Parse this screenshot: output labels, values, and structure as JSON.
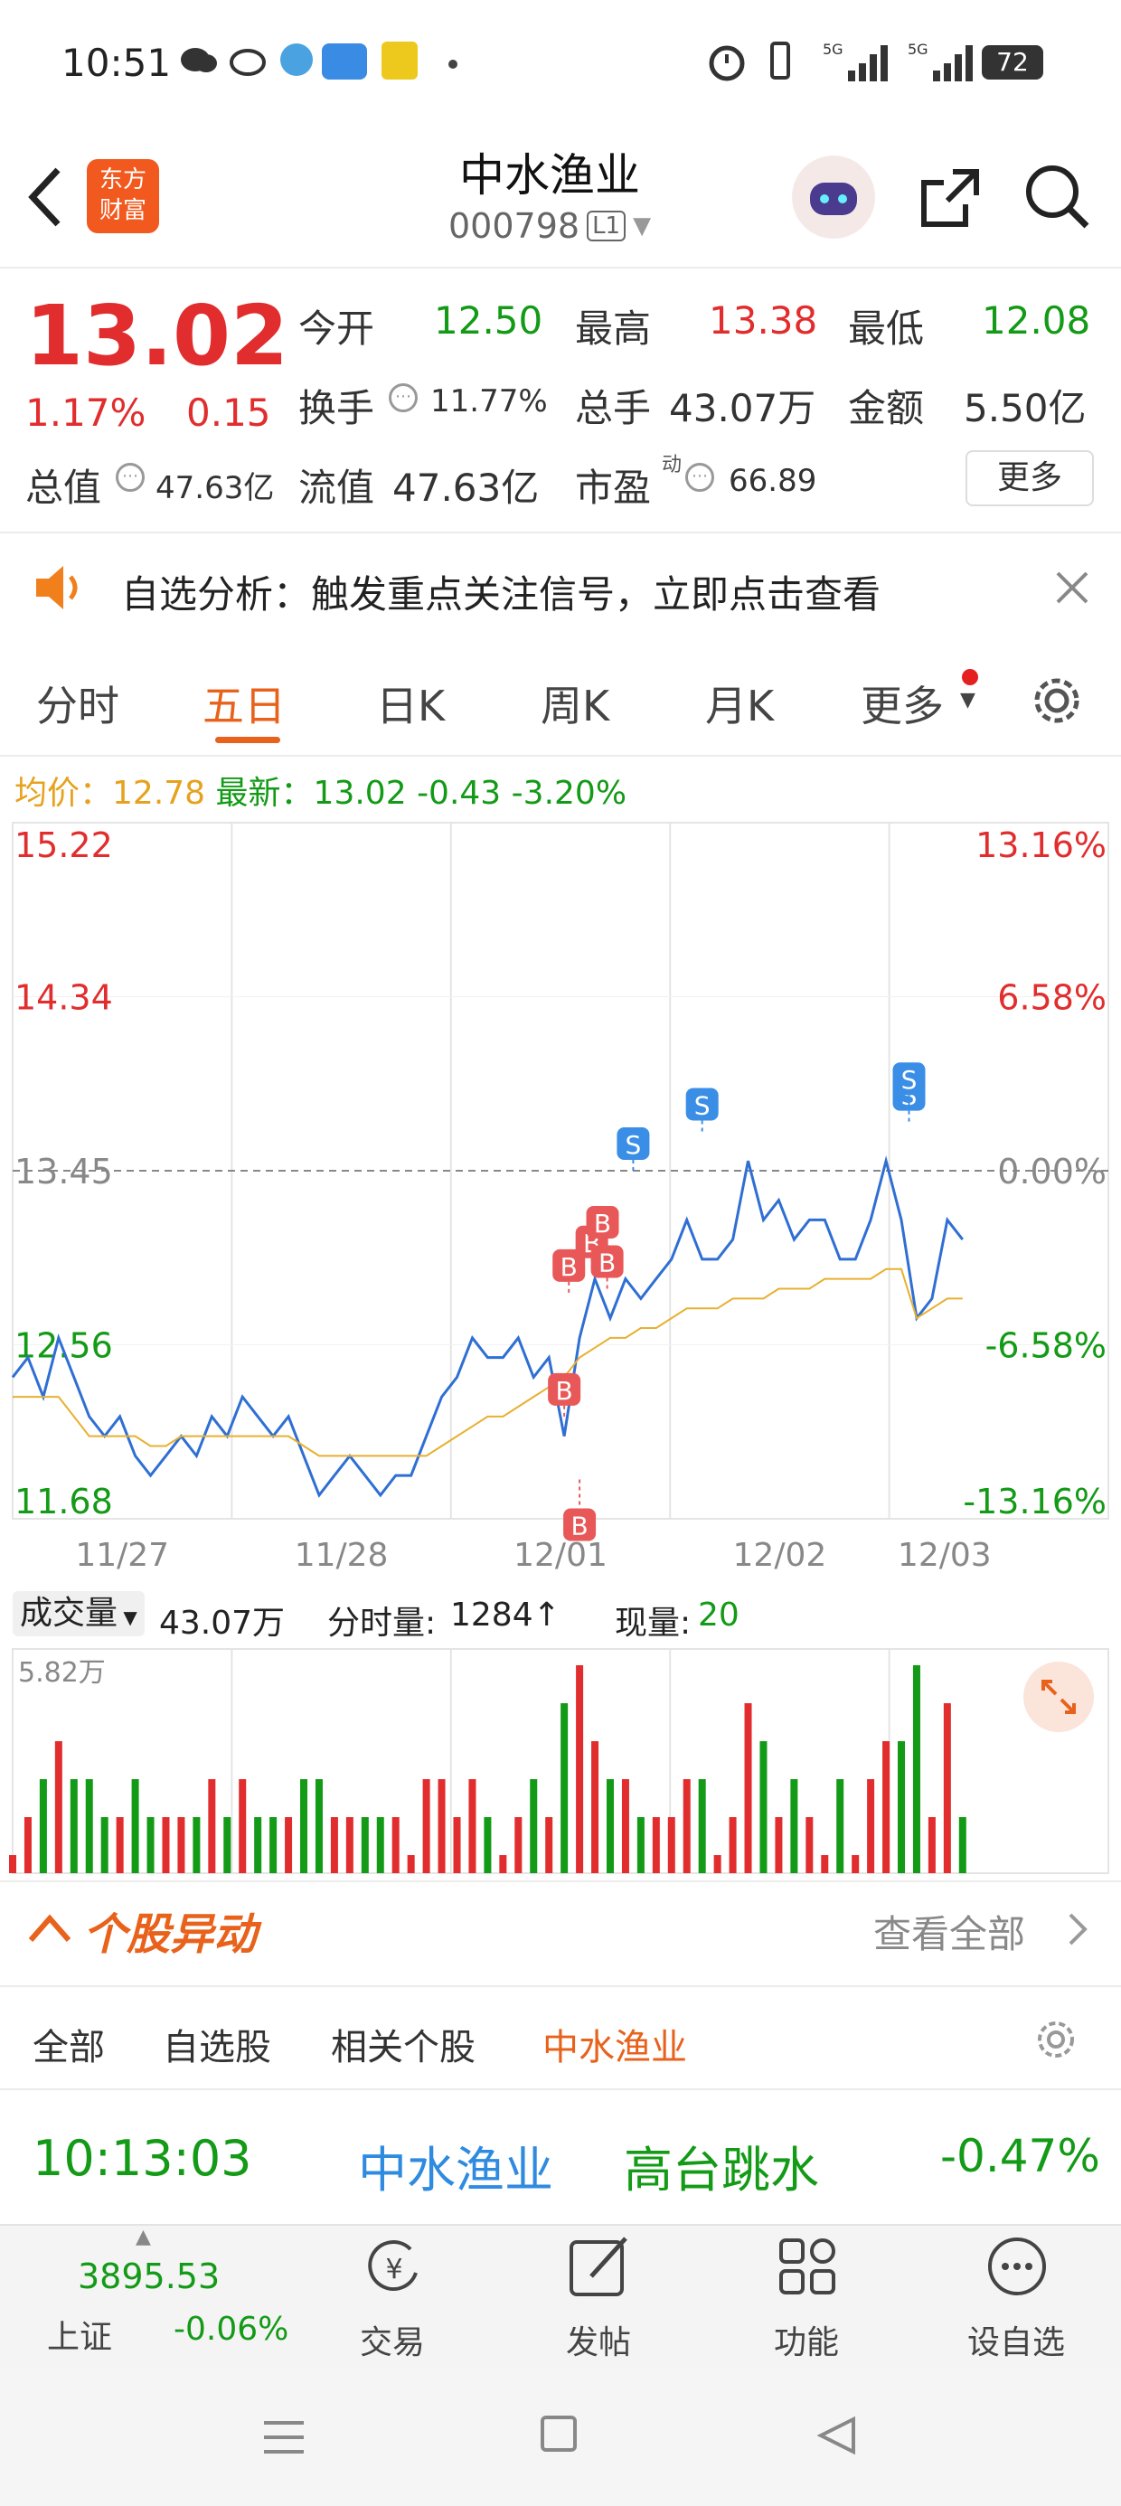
{
  "status": {
    "time": "10:51",
    "battery": "72",
    "sig1": "5G",
    "sig2": "5G"
  },
  "header": {
    "brand_line1": "东方",
    "brand_line2": "财富",
    "title": "中水渔业",
    "code": "000798",
    "level": "L1"
  },
  "quote": {
    "price": "13.02",
    "pct": "1.17%",
    "chg": "0.15",
    "open_label": "今开",
    "open": "12.50",
    "high_label": "最高",
    "high": "13.38",
    "low_label": "最低",
    "low": "12.08",
    "turnover_label": "换手",
    "turnover": "11.77%",
    "vol_label": "总手",
    "vol": "43.07万",
    "amount_label": "金额",
    "amount": "5.50亿",
    "mktcap_label": "总值",
    "mktcap": "47.63亿",
    "float_label": "流值",
    "float": "47.63亿",
    "pe_label": "市盈",
    "pe_sup": "动",
    "pe": "66.89",
    "more": "更多"
  },
  "notice": {
    "text": "自选分析：触发重点关注信号，立即点击查看"
  },
  "tabs": {
    "t1": "分时",
    "t2": "五日",
    "t3": "日K",
    "t4": "周K",
    "t5": "月K",
    "t6": "更多"
  },
  "priceline": {
    "avg_label": "均价：",
    "avg": "12.78",
    "latest_label": "最新：",
    "latest": "13.02",
    "chg": "-0.43",
    "pct": "-3.20%"
  },
  "chart_data": {
    "type": "line",
    "x_labels": [
      "11/27",
      "11/28",
      "12/01",
      "12/02",
      "12/03"
    ],
    "ylim": [
      11.68,
      15.22
    ],
    "y_ticks_left": [
      "15.22",
      "14.34",
      "13.45",
      "12.56",
      "11.68"
    ],
    "y_ticks_right": [
      "13.16%",
      "6.58%",
      "0.00%",
      "-6.58%",
      "-13.16%"
    ],
    "prev_close": 13.45,
    "series": [
      {
        "values": [
          12.4,
          12.5,
          12.3,
          12.6,
          12.4,
          12.2,
          12.1,
          12.2,
          12.0,
          11.9,
          12.0,
          12.1,
          12.0,
          12.2,
          12.1,
          12.3,
          12.2,
          12.1,
          12.2,
          12.0,
          11.8,
          11.9,
          12.0,
          11.9,
          11.8,
          11.9,
          11.9,
          12.1,
          12.3,
          12.4,
          12.6,
          12.5,
          12.5,
          12.6,
          12.4,
          12.5,
          12.1,
          12.6,
          12.9,
          12.7,
          12.9,
          12.8,
          12.9,
          13.0,
          13.2,
          13.0,
          13.0,
          13.1,
          13.5,
          13.2,
          13.3,
          13.1,
          13.2,
          13.2,
          13.0,
          13.0,
          13.2,
          13.5,
          13.2,
          12.7,
          12.8,
          13.2,
          13.1
        ]
      },
      {
        "values": [
          12.3,
          12.3,
          12.3,
          12.3,
          12.2,
          12.1,
          12.1,
          12.1,
          12.1,
          12.05,
          12.05,
          12.1,
          12.1,
          12.1,
          12.1,
          12.1,
          12.1,
          12.1,
          12.1,
          12.05,
          12.0,
          12.0,
          12.0,
          12.0,
          12.0,
          12.0,
          12.0,
          12.0,
          12.05,
          12.1,
          12.15,
          12.2,
          12.2,
          12.25,
          12.3,
          12.35,
          12.4,
          12.5,
          12.55,
          12.6,
          12.6,
          12.65,
          12.65,
          12.7,
          12.75,
          12.75,
          12.75,
          12.8,
          12.8,
          12.8,
          12.85,
          12.85,
          12.85,
          12.9,
          12.9,
          12.9,
          12.9,
          12.95,
          12.95,
          12.7,
          12.75,
          12.8,
          12.8
        ]
      }
    ],
    "markers": [
      "B",
      "B",
      "B",
      "B",
      "B",
      "B",
      "S",
      "S",
      "S",
      "S"
    ],
    "volume_max_label": "5.82万"
  },
  "volume": {
    "label": "成交量",
    "total": "43.07万",
    "tick_label": "分时量:",
    "tick": "1284↑",
    "cur_label": "现量:",
    "cur": "20"
  },
  "movers": {
    "title": "个股异动",
    "view_all": "查看全部",
    "filters": [
      "全部",
      "自选股",
      "相关个股",
      "中水渔业"
    ],
    "row": {
      "time": "10:13:03",
      "name": "中水渔业",
      "event": "高台跳水",
      "pct": "-0.47%"
    }
  },
  "bottom": {
    "index_value": "3895.53",
    "index_name": "上证",
    "index_pct": "-0.06%",
    "trade": "交易",
    "post": "发帖",
    "func": "功能",
    "watch": "设自选"
  }
}
